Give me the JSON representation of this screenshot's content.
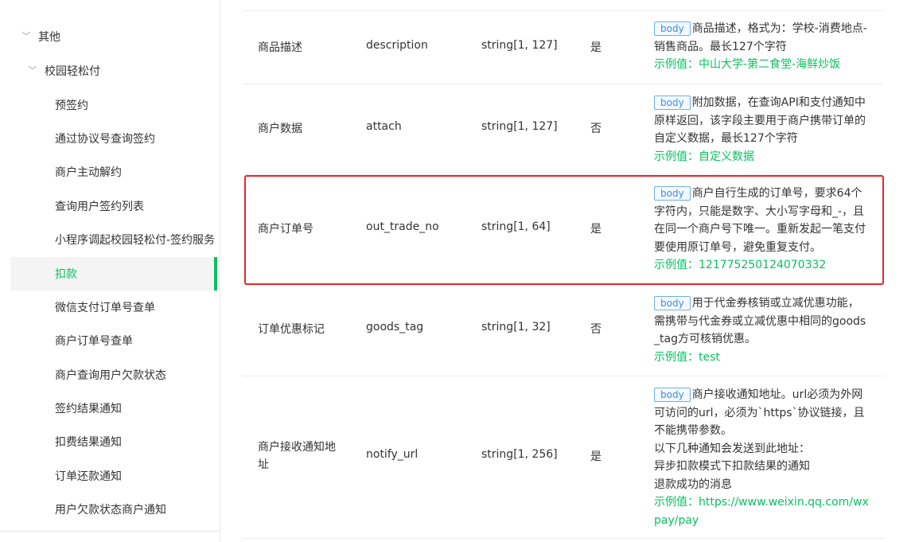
{
  "sidebar": {
    "group_other": "其他",
    "group_campus": "校园轻松付",
    "items": [
      {
        "label": "预签约"
      },
      {
        "label": "通过协议号查询签约"
      },
      {
        "label": "商户主动解约"
      },
      {
        "label": "查询用户签约列表"
      },
      {
        "label": "小程序调起校园轻松付-签约服务"
      },
      {
        "label": "扣款",
        "active": true
      },
      {
        "label": "微信支付订单号查单"
      },
      {
        "label": "商户订单号查单"
      },
      {
        "label": "商户查询用户欠款状态"
      },
      {
        "label": "签约结果通知"
      },
      {
        "label": "扣费结果通知"
      },
      {
        "label": "订单还款通知"
      },
      {
        "label": "用户欠款状态商户通知"
      }
    ]
  },
  "table": {
    "badge_label": "body",
    "rows": [
      {
        "name": "商品描述",
        "key": "description",
        "type": "string[1, 127]",
        "required": "是",
        "desc_lines": [
          "商品描述，格式为：学校-消费地点-",
          "销售商品。最长127个字符"
        ],
        "example": "示例值：中山大学-第二食堂-海鲜炒饭"
      },
      {
        "name": "商户数据",
        "key": "attach",
        "type": "string[1, 127]",
        "required": "否",
        "desc_lines": [
          "附加数据，在查询API和支付通知中",
          "原样返回，该字段主要用于商户携带订单的",
          "自定义数据，最长127个字符"
        ],
        "example": "示例值：自定义数据"
      },
      {
        "name": "商户订单号",
        "key": "out_trade_no",
        "type": "string[1, 64]",
        "required": "是",
        "desc_lines": [
          "商户自行生成的订单号，要求64个",
          "字符内，只能是数字、大小写字母和_-，且",
          "在同一个商户号下唯一。重新发起一笔支付",
          "要使用原订单号，避免重复支付。"
        ],
        "example": "示例值：121775250124070332"
      },
      {
        "name": "订单优惠标记",
        "key": "goods_tag",
        "type": "string[1, 32]",
        "required": "否",
        "desc_lines": [
          "用于代金券核销或立减优惠功能，",
          "需携带与代金券或立减优惠中相同的goods",
          "_tag方可核销优惠。"
        ],
        "example": "示例值：test"
      },
      {
        "name_lines": [
          "商户接收通知地",
          "址"
        ],
        "key": "notify_url",
        "type": "string[1, 256]",
        "required": "是",
        "desc_lines": [
          "商户接收通知地址。url必须为外网",
          "可访问的url，必须为`https`协议链接，且",
          "不能携带参数。",
          "以下几种通知会发送到此地址：",
          "异步扣款模式下扣款结果的通知",
          "退款成功的消息"
        ],
        "example_lines": [
          "示例值：https://www.weixin.qq.com/wx",
          "pay/pay"
        ]
      }
    ]
  }
}
